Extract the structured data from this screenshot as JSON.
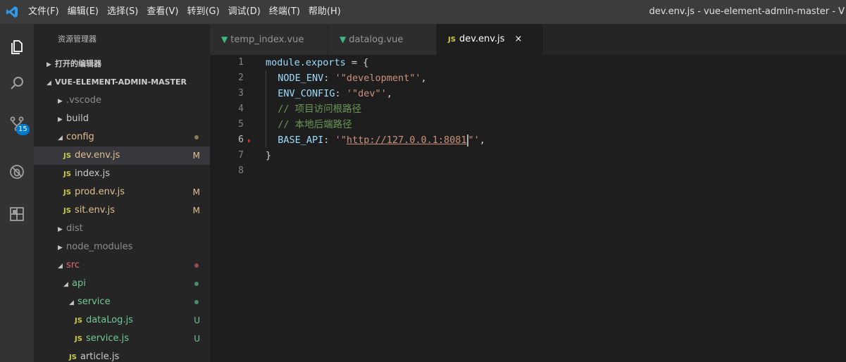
{
  "menu": {
    "items": [
      "文件(F)",
      "编辑(E)",
      "选择(S)",
      "查看(V)",
      "转到(G)",
      "调试(D)",
      "终端(T)",
      "帮助(H)"
    ]
  },
  "window": {
    "title": "dev.env.js - vue-element-admin-master - V"
  },
  "activity": {
    "scm_badge": "15"
  },
  "sidebar": {
    "title": "资源管理器",
    "open_editors": "打开的编辑器",
    "project": "VUE-ELEMENT-ADMIN-MASTER",
    "items": [
      {
        "label": ".vscode",
        "type": "folder",
        "expanded": false,
        "status": ""
      },
      {
        "label": "build",
        "type": "folder",
        "expanded": false,
        "status": ""
      },
      {
        "label": "config",
        "type": "folder",
        "expanded": true,
        "status": "dot"
      },
      {
        "label": "dev.env.js",
        "type": "js",
        "status": "M"
      },
      {
        "label": "index.js",
        "type": "js",
        "status": ""
      },
      {
        "label": "prod.env.js",
        "type": "js",
        "status": "M"
      },
      {
        "label": "sit.env.js",
        "type": "js",
        "status": "M"
      },
      {
        "label": "dist",
        "type": "folder",
        "expanded": false,
        "status": ""
      },
      {
        "label": "node_modules",
        "type": "folder",
        "expanded": false,
        "status": ""
      },
      {
        "label": "src",
        "type": "folder",
        "expanded": true,
        "status": "dot"
      },
      {
        "label": "api",
        "type": "folder",
        "expanded": true,
        "status": "dot"
      },
      {
        "label": "service",
        "type": "folder",
        "expanded": true,
        "status": "dot"
      },
      {
        "label": "dataLog.js",
        "type": "js",
        "status": "U"
      },
      {
        "label": "service.js",
        "type": "js",
        "status": "U"
      },
      {
        "label": "article.js",
        "type": "js",
        "status": ""
      }
    ]
  },
  "tabs": [
    {
      "label": "temp_index.vue",
      "icon": "vue-icon",
      "active": false
    },
    {
      "label": "datalog.vue",
      "icon": "vue-icon",
      "active": false
    },
    {
      "label": "dev.env.js",
      "icon": "js-icon",
      "active": true
    }
  ],
  "editor": {
    "line_numbers": [
      "1",
      "2",
      "3",
      "4",
      "5",
      "6",
      "7",
      "8"
    ],
    "current_line": "6",
    "code": {
      "l1_key": "module.exports",
      "l1_rest": " = {",
      "l2_key": "NODE_ENV",
      "l2_val": "'\"development\"'",
      "l3_key": "ENV_CONFIG",
      "l3_val": "'\"dev\"'",
      "l4_comment": "// 项目访问根路径",
      "l5_comment": "// 本地后端路径",
      "l6_key": "BASE_API",
      "l6_val_pre": "'\"",
      "l6_url": "http://127.0.0.1:8081",
      "l6_val_post": "\"'",
      "l7": "}"
    }
  },
  "labels": {
    "js": "JS",
    "close": "×",
    "colon": ": ",
    "comma": ","
  },
  "colors": {
    "accent": "#007acc",
    "modified": "#e2c08d",
    "untracked": "#73c991",
    "vue": "#41b883",
    "js": "#cbcb41"
  }
}
